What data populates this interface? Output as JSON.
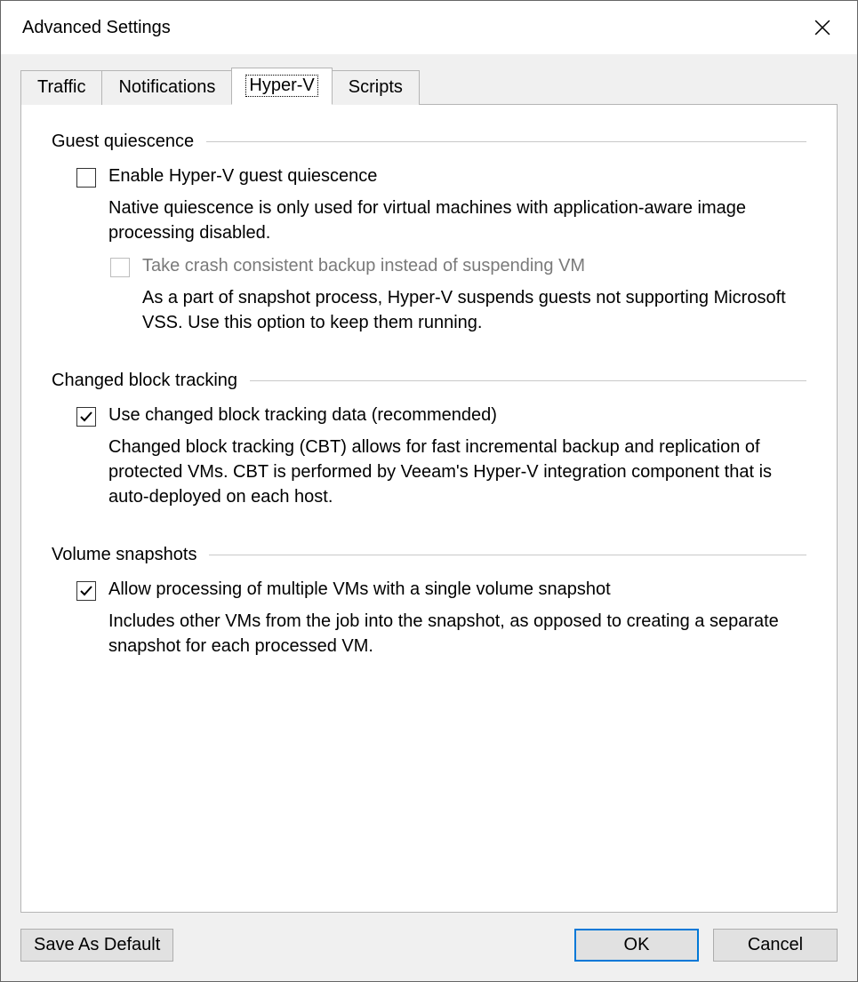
{
  "window": {
    "title": "Advanced Settings"
  },
  "tabs": {
    "traffic": "Traffic",
    "notifications": "Notifications",
    "hyperv": "Hyper-V",
    "scripts": "Scripts"
  },
  "groups": {
    "quiescence": {
      "legend": "Guest quiescence",
      "enable_label": "Enable Hyper-V guest quiescence",
      "enable_desc": "Native quiescence is only used for virtual machines with application-aware image processing disabled.",
      "crash_label": "Take crash consistent backup instead of suspending VM",
      "crash_desc": "As a part of snapshot process, Hyper-V suspends guests not supporting Microsoft VSS. Use this option to keep them running."
    },
    "cbt": {
      "legend": "Changed block tracking",
      "use_label": "Use changed block tracking data (recommended)",
      "use_desc": "Changed block tracking (CBT) allows for fast incremental backup and replication of protected VMs. CBT is performed by Veeam's Hyper-V integration component that is auto-deployed on each host."
    },
    "snapshots": {
      "legend": "Volume snapshots",
      "allow_label": "Allow processing of multiple VMs with a single volume snapshot",
      "allow_desc": "Includes other VMs from the job into the snapshot, as opposed to creating a separate snapshot for each processed VM."
    }
  },
  "buttons": {
    "save_default": "Save As Default",
    "ok": "OK",
    "cancel": "Cancel"
  },
  "state": {
    "active_tab": "hyperv",
    "enable_quiescence_checked": false,
    "crash_consistent_checked": false,
    "crash_consistent_disabled": true,
    "use_cbt_checked": true,
    "allow_multi_vm_checked": true
  }
}
